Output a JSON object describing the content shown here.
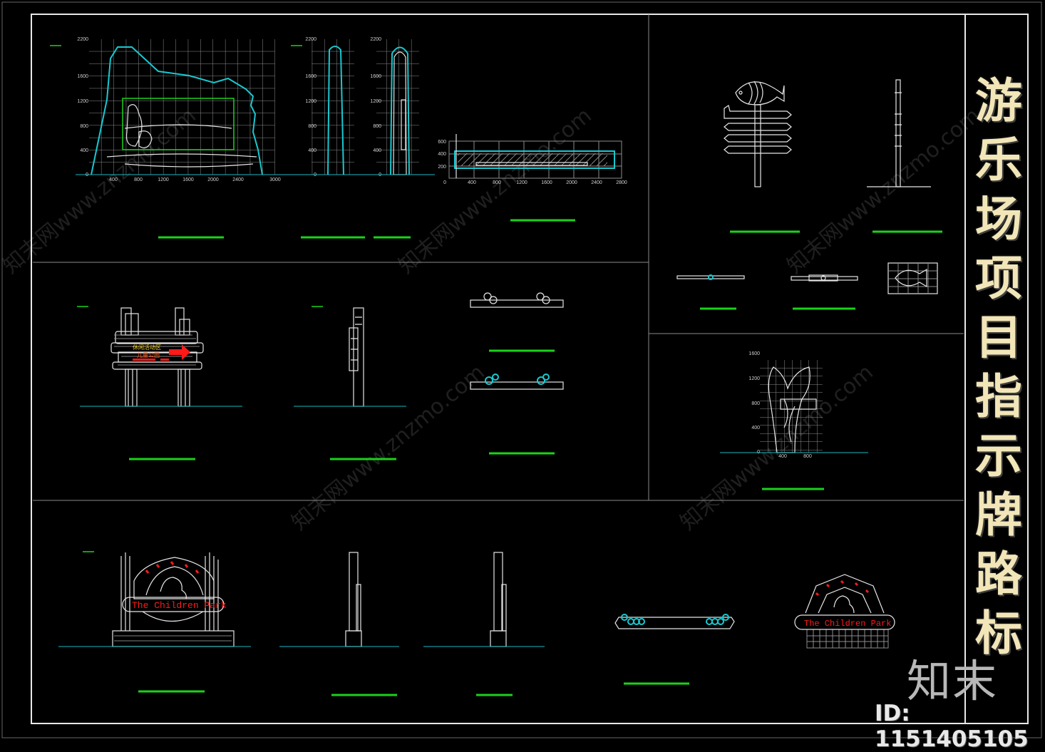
{
  "drawing": {
    "title_chars": [
      "游",
      "乐",
      "场",
      "项",
      "目",
      "指",
      "示",
      "牌",
      "路",
      "标"
    ],
    "title": "游乐场项目指示牌路标",
    "logo_text": "知末",
    "id_label": "ID: 1151405105",
    "watermark": "知末网www.znzmo.com"
  },
  "rock_sign": {
    "y_ticks": [
      "2200",
      "1600",
      "1200",
      "800",
      "400",
      "0"
    ],
    "x_ticks": [
      "400",
      "800",
      "1200",
      "1600",
      "2000",
      "2400",
      "3000"
    ],
    "side_y_ticks": [
      "2200",
      "1600",
      "1200",
      "800",
      "400",
      "0"
    ]
  },
  "rock_plan": {
    "y_ticks": [
      "600",
      "400",
      "200",
      "0"
    ],
    "x_ticks": [
      "400",
      "800",
      "1200",
      "1600",
      "2000",
      "2400",
      "2800"
    ]
  },
  "directional_sign": {
    "line1": "休闲活动区",
    "line2": "儿童公园"
  },
  "tree_sign": {
    "y_ticks": [
      "1600",
      "1200",
      "800",
      "400",
      "0"
    ],
    "x_ticks": [
      "400",
      "800"
    ]
  },
  "gate_sign": {
    "text": "The Children Park"
  },
  "gate_sign_small": {
    "text": "The Children Park"
  },
  "colors": {
    "background": "#000000",
    "linework": "#e6e6e6",
    "outline_cyan": "#19c8d0",
    "title_label_green": "#1ad21a",
    "sign_text_red": "#ff1a1a",
    "sign_text_yellow": "#f0d020",
    "title_text": "#f2e6b8"
  }
}
